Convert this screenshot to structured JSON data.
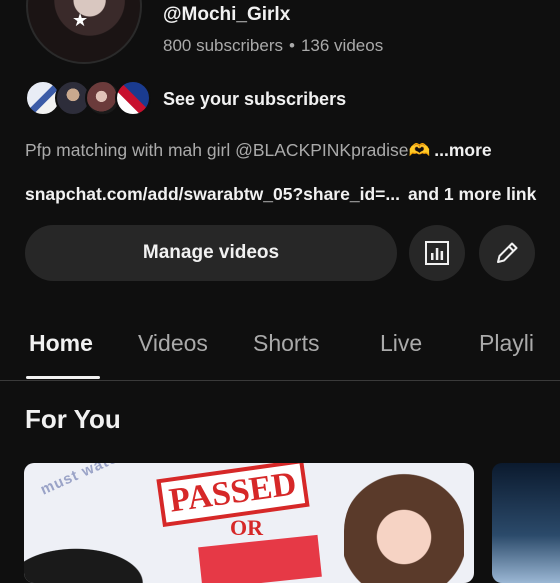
{
  "channel": {
    "handle": "@Mochi_Girlx",
    "subscribers": "800 subscribers",
    "separator": "•",
    "videos": "136 videos"
  },
  "subscribers_row": {
    "label": "See your subscribers"
  },
  "description": {
    "text": "Pfp matching with mah girl @BLACKPINKpradise",
    "emoji": "🫶",
    "more_label": "...more"
  },
  "links": {
    "primary": "snapchat.com/add/swarabtw_05?share_id=...",
    "more": "and 1 more link"
  },
  "actions": {
    "manage_label": "Manage videos",
    "analytics_icon": "analytics-icon",
    "edit_icon": "pencil-icon"
  },
  "tabs": [
    {
      "label": "Home",
      "active": true
    },
    {
      "label": "Videos",
      "active": false
    },
    {
      "label": "Shorts",
      "active": false
    },
    {
      "label": "Live",
      "active": false
    },
    {
      "label": "Playli",
      "active": false
    }
  ],
  "section": {
    "title": "For You"
  },
  "cards": [
    {
      "overlay_text": "must watch",
      "headline": "PASSED",
      "sub": "OR"
    },
    {}
  ],
  "colors": {
    "background": "#0f0f0f",
    "surface": "#272727",
    "text_primary": "#f1f1f1",
    "text_secondary": "#aaaaaa"
  }
}
